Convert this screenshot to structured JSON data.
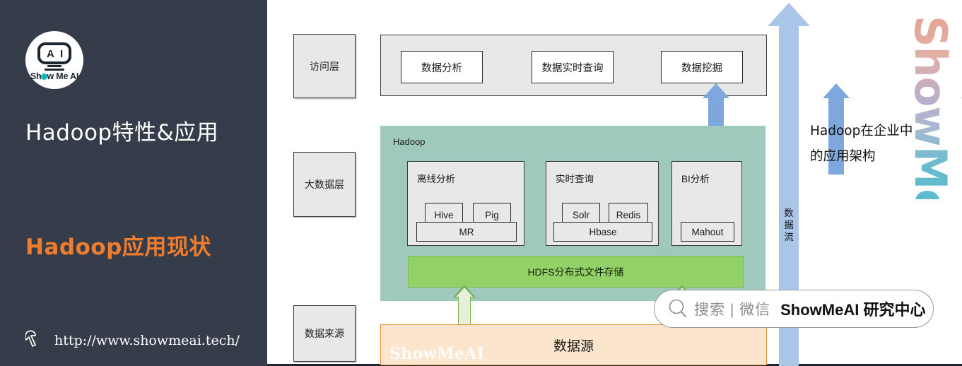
{
  "left_panel": {
    "logo": {
      "head_letters": [
        "A",
        "I"
      ],
      "brand_pre": "Sh",
      "brand_post": "w Me AI"
    },
    "title_main": "Hadoop特性&应用",
    "title_sub": "Hadoop应用现状",
    "site_url": "http://www.showmeai.tech/",
    "background_color": "#343d49",
    "accent_color": "#f07d2e"
  },
  "diagram": {
    "layer_labels": [
      {
        "name": "access-layer",
        "text": "访问层"
      },
      {
        "name": "bigdata-layer",
        "text": "大数据层"
      },
      {
        "name": "datasource-layer",
        "text": "数据来源"
      }
    ],
    "access_layer": {
      "boxes": [
        {
          "name": "data-analysis",
          "text": "数据分析"
        },
        {
          "name": "realtime-query",
          "text": "数据实时查询"
        },
        {
          "name": "data-mining",
          "text": "数据挖掘"
        }
      ]
    },
    "hadoop_panel": {
      "label": "Hadoop",
      "color": "#9fc9bd",
      "groups": [
        {
          "name": "offline-analysis",
          "title": "离线分析",
          "top_items": [
            "Hive",
            "Pig"
          ],
          "base_item": "MR"
        },
        {
          "name": "realtime-query",
          "title": "实时查询",
          "top_items": [
            "Solr",
            "Redis"
          ],
          "base_item": "Hbase"
        },
        {
          "name": "bi-analysis",
          "title": "BI分析",
          "top_items": [],
          "base_item": "Mahout"
        }
      ]
    },
    "hdfs_bar": {
      "text": "HDFS分布式文件存储",
      "color": "#92d167"
    },
    "data_source": {
      "text": "数据源",
      "watermark": "ShowMeAI",
      "fill_color": "#fce5cd",
      "border_color": "#e69138"
    },
    "flow_arrow": {
      "label": "数据流",
      "color": "#a9c5e8"
    },
    "right_caption_line1": "Hadoop在企业中",
    "right_caption_line2": "的应用架构",
    "vertical_watermark": "ShowMeAI"
  },
  "pill_watermark": {
    "search_text": "搜索 | 微信",
    "brand_text": "ShowMeAI 研究中心"
  }
}
